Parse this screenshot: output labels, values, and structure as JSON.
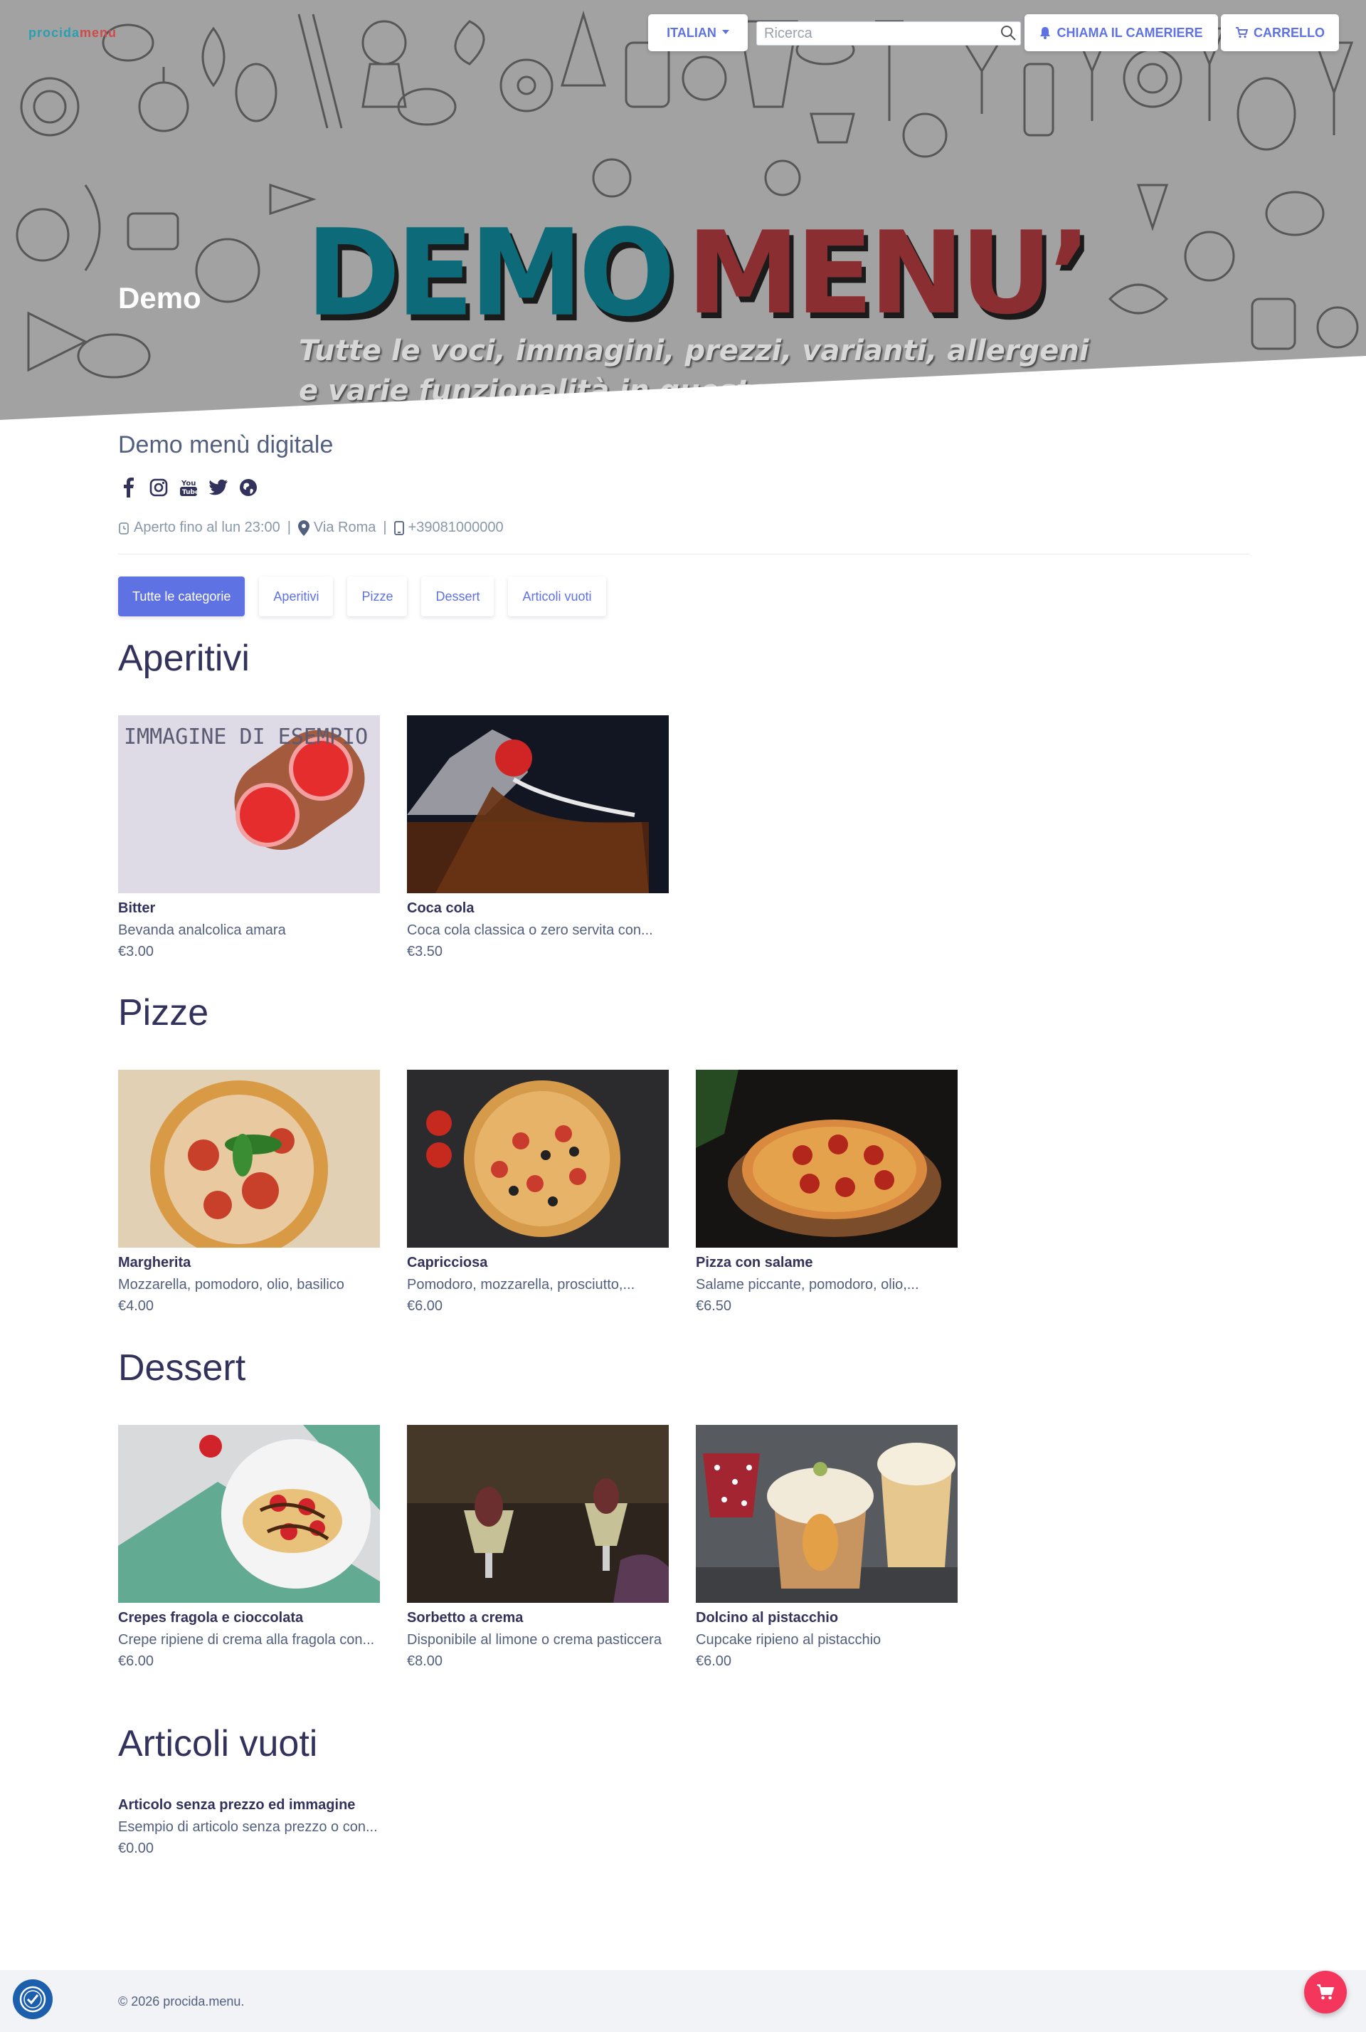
{
  "header": {
    "logo_part1": "procida",
    "logo_part2": "menu",
    "language_label": "ITALIAN",
    "search_placeholder": "Ricerca",
    "waiter_label": "CHIAMA IL CAMERIERE",
    "cart_label": "CARRELLO"
  },
  "hero": {
    "title_demo": "DEMO",
    "title_menu": "MENU’",
    "tagline": "Tutte le voci, immagini, prezzi, varianti, allergeni e varie funzionalità in questo menu sono a fine…",
    "restaurant_short": "Demo"
  },
  "restaurant": {
    "title": "Demo menù digitale",
    "social_icons": [
      "facebook-icon",
      "instagram-icon",
      "youtube-icon",
      "twitter-icon",
      "globe-icon"
    ],
    "hours": "Aperto fino al lun 23:00",
    "address": "Via Roma",
    "phone": "+39081000000"
  },
  "categories": [
    "Tutte le categorie",
    "Aperitivi",
    "Pizze",
    "Dessert",
    "Articoli vuoti"
  ],
  "sections": [
    {
      "title": "Aperitivi",
      "items": [
        {
          "name": "Bitter",
          "desc": "Bevanda analcolica amara",
          "price": "€3.00",
          "image_text": "IMMAGINE DI ESEMPIO"
        },
        {
          "name": "Coca cola",
          "desc": "Coca cola classica o zero servita con...",
          "price": "€3.50"
        }
      ]
    },
    {
      "title": "Pizze",
      "items": [
        {
          "name": "Margherita",
          "desc": "Mozzarella, pomodoro, olio, basilico",
          "price": "€4.00"
        },
        {
          "name": "Capricciosa",
          "desc": "Pomodoro, mozzarella, prosciutto,...",
          "price": "€6.00"
        },
        {
          "name": "Pizza con salame",
          "desc": "Salame piccante, pomodoro, olio,...",
          "price": "€6.50"
        }
      ]
    },
    {
      "title": "Dessert",
      "items": [
        {
          "name": "Crepes fragola e cioccolata",
          "desc": "Crepe ripiene di crema alla fragola con...",
          "price": "€6.00"
        },
        {
          "name": "Sorbetto a crema",
          "desc": "Disponibile al limone o crema pasticcera",
          "price": "€8.00"
        },
        {
          "name": "Dolcino al pistacchio",
          "desc": "Cupcake ripieno al pistacchio",
          "price": "€6.00"
        }
      ]
    },
    {
      "title": "Articoli vuoti",
      "items": [
        {
          "name": "Articolo senza prezzo ed immagine",
          "desc": "Esempio di articolo senza prezzo o con...",
          "price": "€0.00"
        }
      ]
    }
  ],
  "footer": {
    "copyright": "© 2026 procida.menu."
  },
  "colors": {
    "accent": "#5e72e4",
    "heading": "#32325d",
    "fab": "#f5365c"
  }
}
